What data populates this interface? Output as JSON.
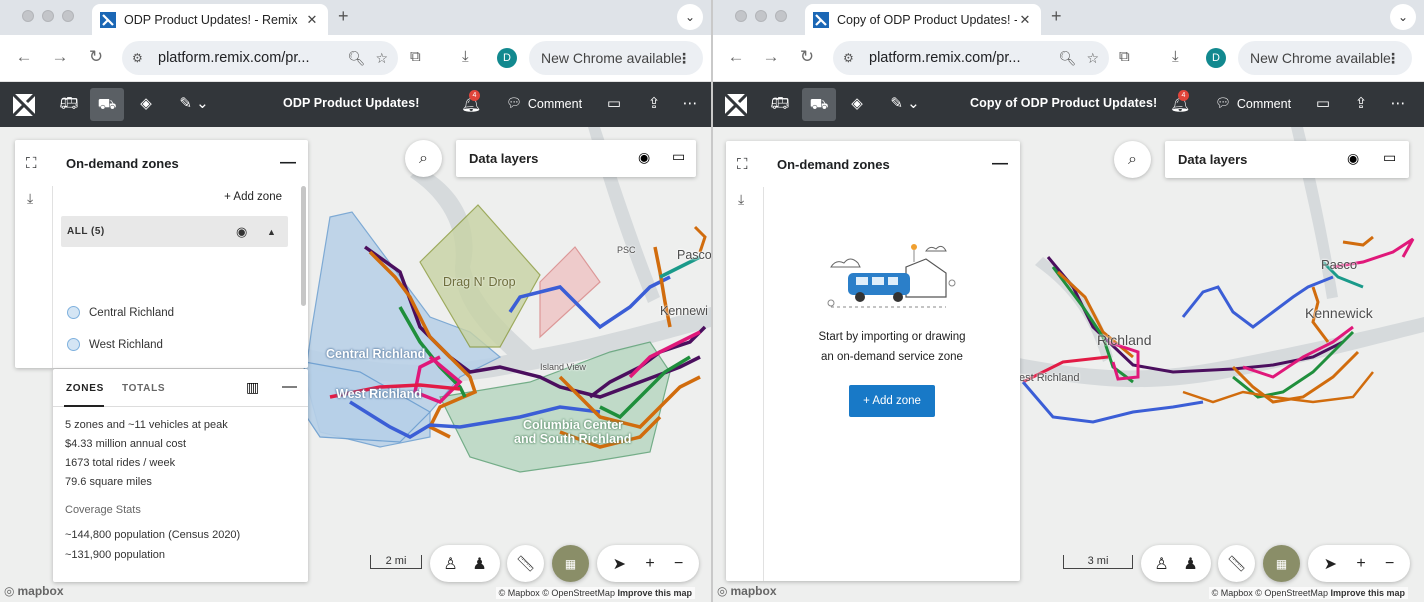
{
  "left": {
    "tab_title": "ODP Product Updates! - Remix",
    "url": "platform.remix.com/pr...",
    "profile_initial": "D",
    "new_chrome": "New Chrome available",
    "app_title": "ODP Product Updates!",
    "notif_count": "4",
    "comment_label": "Comment",
    "panel_title": "On-demand zones",
    "add_zone_link": "+ Add zone",
    "all_label": "ALL (5)",
    "zones": [
      {
        "name": "Central Richland",
        "color": "#7fb1de"
      },
      {
        "name": "West Richland",
        "color": "#7fb1de"
      },
      {
        "name": "Columbia Center and South Richla...",
        "color": "#3f9a5c"
      },
      {
        "name": "Drag N' Drop",
        "color": "#8a9a3a"
      }
    ],
    "tab_zones": "ZONES",
    "tab_totals": "TOTALS",
    "stats": [
      "5 zones and ~11 vehicles at peak",
      "$4.33 million annual cost",
      "1673 total rides / week",
      "79.6 square miles"
    ],
    "coverage_title": "Coverage Stats",
    "coverage": [
      "~144,800 population (Census 2020)",
      "~131,900 population"
    ],
    "data_layers": "Data layers",
    "scale": "2 mi",
    "map_labels": {
      "central": "Central Richland",
      "west": "West Richland",
      "columbia": "Columbia Center",
      "columbia2": "and South Richland",
      "drag": "Drag N' Drop",
      "pasco": "Pasco",
      "kennewick": "Kennewi",
      "psc": "PSC",
      "island": "Island View"
    }
  },
  "right": {
    "tab_title": "Copy of ODP Product Updates! - Remix",
    "url": "platform.remix.com/pr...",
    "profile_initial": "D",
    "new_chrome": "New Chrome available",
    "app_title": "Copy of ODP Product Updates!",
    "notif_count": "4",
    "comment_label": "Comment",
    "panel_title": "On-demand zones",
    "empty_line1": "Start by importing or drawing",
    "empty_line2": "an on-demand service zone",
    "add_zone_button": "+ Add zone",
    "data_layers": "Data layers",
    "scale": "3 mi",
    "map_labels": {
      "richland": "Richland",
      "west": "est Richland",
      "pasco": "Pasco",
      "kennewick": "Kennewick"
    }
  },
  "common": {
    "mapbox": "mapbox",
    "attribution": "© Mapbox © OpenStreetMap",
    "improve": "Improve this map"
  }
}
